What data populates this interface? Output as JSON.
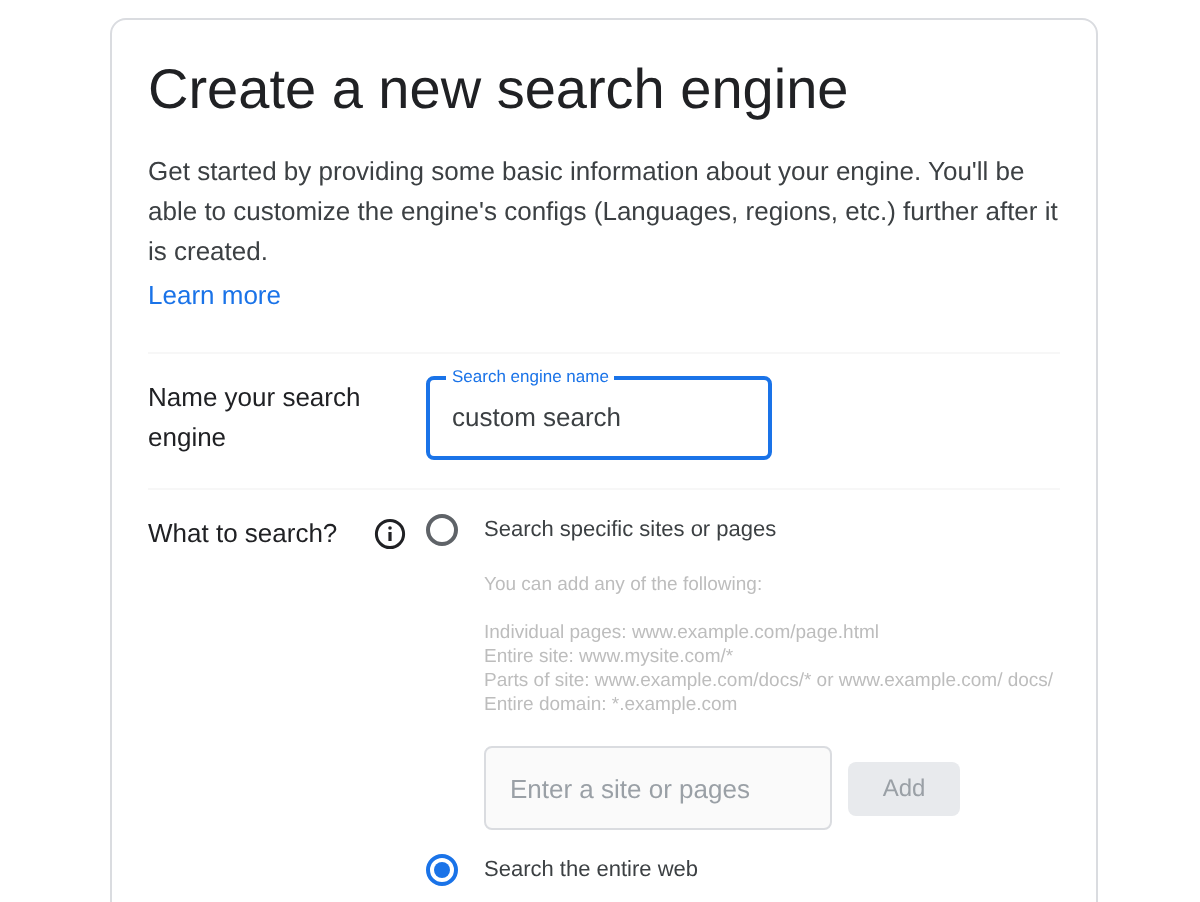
{
  "title": "Create a new search engine",
  "intro": "Get started by providing some basic information about your engine. You'll be able to customize the engine's configs (Languages, regions, etc.) further after it is created.",
  "learn_more": "Learn more",
  "name_row": {
    "label": "Name your search engine",
    "field_label": "Search engine name",
    "value": "custom search",
    "focused": true
  },
  "what_row": {
    "label": "What to search?",
    "options": [
      {
        "label": "Search specific sites or pages",
        "selected": false
      },
      {
        "label": "Search the entire web",
        "selected": true
      }
    ],
    "hint_lines": [
      "You can add any of the following:",
      "Individual pages: www.example.com/page.html",
      "Entire site: www.mysite.com/*",
      "Parts of site: www.example.com/docs/* or www.example.com/ docs/",
      "Entire domain: *.example.com"
    ],
    "site_field": {
      "placeholder": "Enter a site or pages"
    },
    "add_button": "Add",
    "disabled": true
  }
}
